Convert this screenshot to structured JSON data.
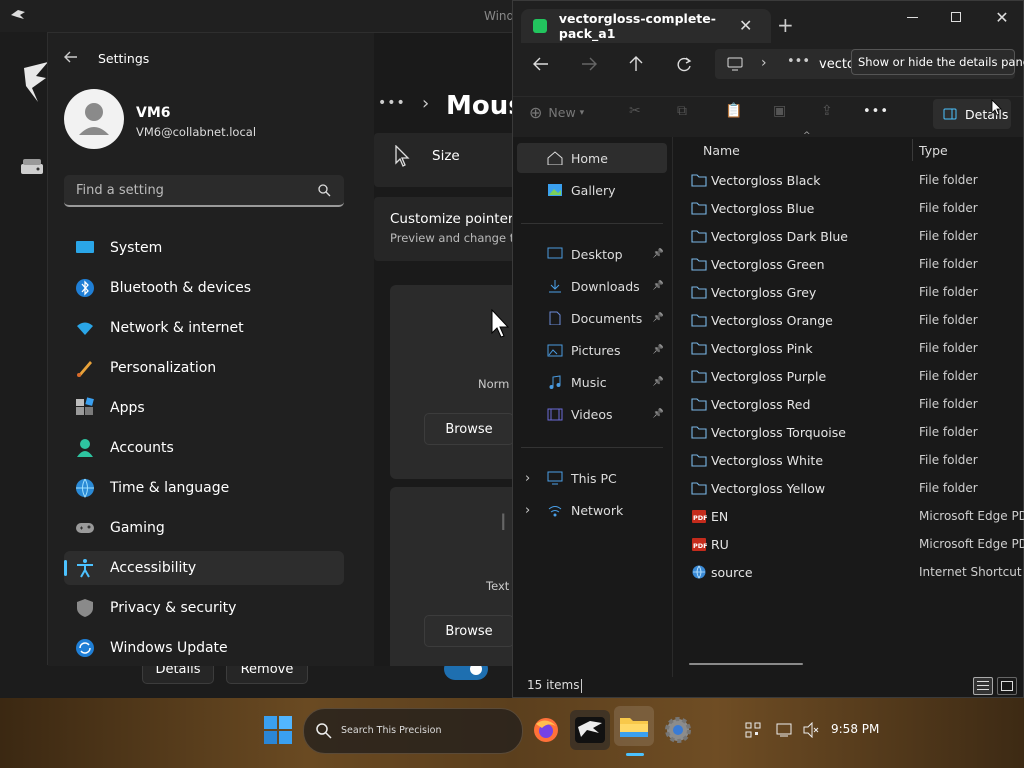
{
  "background_window": {
    "title": "Wind",
    "details_button": "Details",
    "remove_button": "Remove"
  },
  "settings": {
    "app_title": "Settings",
    "user": {
      "name": "VM6",
      "email": "VM6@collabnet.local"
    },
    "search": {
      "placeholder": "Find a setting"
    },
    "nav": [
      {
        "label": "System",
        "icon": "system-icon"
      },
      {
        "label": "Bluetooth & devices",
        "icon": "bluetooth-icon"
      },
      {
        "label": "Network & internet",
        "icon": "wifi-icon"
      },
      {
        "label": "Personalization",
        "icon": "brush-icon"
      },
      {
        "label": "Apps",
        "icon": "apps-icon"
      },
      {
        "label": "Accounts",
        "icon": "accounts-icon"
      },
      {
        "label": "Time & language",
        "icon": "globe-icon"
      },
      {
        "label": "Gaming",
        "icon": "gamepad-icon"
      },
      {
        "label": "Accessibility",
        "icon": "accessibility-icon",
        "active": true
      },
      {
        "label": "Privacy & security",
        "icon": "shield-icon"
      },
      {
        "label": "Windows Update",
        "icon": "update-icon"
      }
    ],
    "content": {
      "breadcrumb_more": "•••",
      "breadcrumb_sep": "›",
      "page_title": "Mous",
      "size_label": "Size",
      "customize_title": "Customize pointer i",
      "customize_desc": "Preview and change th",
      "card1_label": "Norm",
      "card1_browse": "Browse",
      "card2_label": "Text",
      "card2_browse": "Browse"
    }
  },
  "explorer": {
    "tab_title": "vectorgloss-complete-pack_a1",
    "address_text": "vectorgloss-c",
    "tooltip": "Show or hide the details pane.",
    "toolbar": {
      "new_label": "New",
      "details_label": "Details",
      "more": "•••"
    },
    "nav_pane": {
      "quick": [
        {
          "label": "Home",
          "icon": "home-icon",
          "active": true
        },
        {
          "label": "Gallery",
          "icon": "gallery-icon"
        }
      ],
      "pinned": [
        {
          "label": "Desktop",
          "icon": "desktop-icon"
        },
        {
          "label": "Downloads",
          "icon": "download-icon"
        },
        {
          "label": "Documents",
          "icon": "documents-icon"
        },
        {
          "label": "Pictures",
          "icon": "pictures-icon"
        },
        {
          "label": "Music",
          "icon": "music-icon"
        },
        {
          "label": "Videos",
          "icon": "videos-icon"
        }
      ],
      "drives": [
        {
          "label": "This PC",
          "icon": "pc-icon"
        },
        {
          "label": "Network",
          "icon": "network-icon"
        }
      ]
    },
    "columns": {
      "name": "Name",
      "type": "Type"
    },
    "files": [
      {
        "name": "Vectorgloss Black",
        "type": "File folder",
        "kind": "folder"
      },
      {
        "name": "Vectorgloss Blue",
        "type": "File folder",
        "kind": "folder"
      },
      {
        "name": "Vectorgloss Dark Blue",
        "type": "File folder",
        "kind": "folder"
      },
      {
        "name": "Vectorgloss Green",
        "type": "File folder",
        "kind": "folder"
      },
      {
        "name": "Vectorgloss Grey",
        "type": "File folder",
        "kind": "folder"
      },
      {
        "name": "Vectorgloss Orange",
        "type": "File folder",
        "kind": "folder"
      },
      {
        "name": "Vectorgloss Pink",
        "type": "File folder",
        "kind": "folder"
      },
      {
        "name": "Vectorgloss Purple",
        "type": "File folder",
        "kind": "folder"
      },
      {
        "name": "Vectorgloss Red",
        "type": "File folder",
        "kind": "folder"
      },
      {
        "name": "Vectorgloss Torquoise",
        "type": "File folder",
        "kind": "folder"
      },
      {
        "name": "Vectorgloss White",
        "type": "File folder",
        "kind": "folder"
      },
      {
        "name": "Vectorgloss Yellow",
        "type": "File folder",
        "kind": "folder"
      },
      {
        "name": "EN",
        "type": "Microsoft Edge PDF",
        "kind": "pdf"
      },
      {
        "name": "RU",
        "type": "Microsoft Edge PDF",
        "kind": "pdf"
      },
      {
        "name": "source",
        "type": "Internet Shortcut",
        "kind": "link"
      }
    ],
    "status": "15 items"
  },
  "taskbar": {
    "search_placeholder": "Search This Precision",
    "time": "9:58 PM",
    "apps": [
      "firefox-icon",
      "eagle-app-icon",
      "file-explorer-icon",
      "settings-gear-icon"
    ]
  },
  "colors": {
    "accent": "#4cc2ff",
    "folder_outline": "#7ab8e6",
    "pdf_red": "#c42b1c"
  }
}
